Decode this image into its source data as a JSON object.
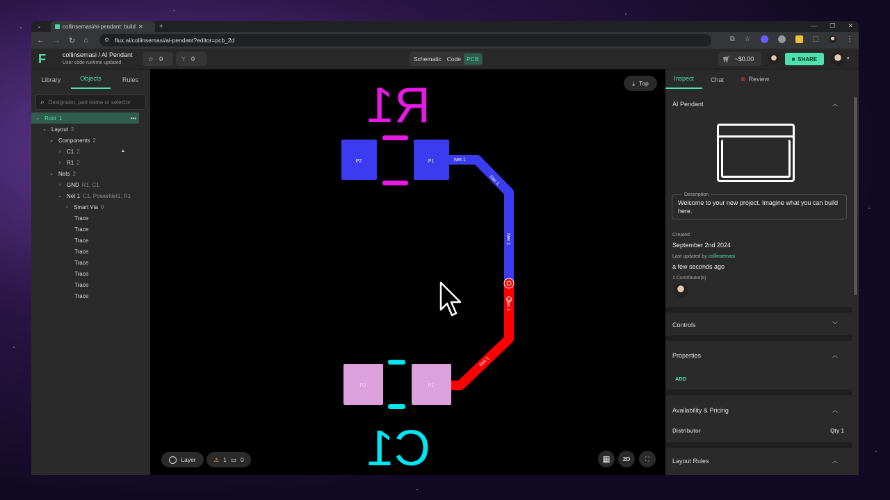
{
  "browser": {
    "tab_title": "collinsemasi/ai-pendant: build",
    "url": "flux.ai/collinsemasi/ai-pendant?editor=pcb_2d"
  },
  "header": {
    "project_path": "collinsemasi / AI Pendant",
    "status": "User code runtime updated",
    "stars": "0",
    "forks": "0",
    "modes": [
      "Schematic",
      "Code",
      "PCB"
    ],
    "active_mode": "PCB",
    "cart_price": "~$0.00",
    "share_label": "SHARE"
  },
  "left_panel": {
    "tabs": [
      "Library",
      "Objects",
      "Rules"
    ],
    "active_tab": "Objects",
    "search_placeholder": "Designator, part name or selector",
    "tree": {
      "root": {
        "label": "Root",
        "count": "1"
      },
      "layout": {
        "label": "Layout",
        "count": "2"
      },
      "components": {
        "label": "Components",
        "count": "2"
      },
      "c1": {
        "label": "C1",
        "count": "2"
      },
      "r1": {
        "label": "R1",
        "count": "2"
      },
      "nets": {
        "label": "Nets",
        "count": "2"
      },
      "gnd": {
        "label": "GND",
        "detail": "R1, C1"
      },
      "net1": {
        "label": "Net 1",
        "detail": "C1, PowerNet1, R1"
      },
      "smart_via": {
        "label": "Smart Via",
        "count": "9"
      },
      "traces": [
        "Trace",
        "Trace",
        "Trace",
        "Trace",
        "Trace",
        "Trace",
        "Trace",
        "Trace"
      ]
    }
  },
  "canvas": {
    "view_label": "Top",
    "layer_label": "Layer",
    "warnings": "1",
    "comments": "0",
    "mode_2d": "2D",
    "r1_designator": "R1",
    "c1_designator": "C1",
    "pad_p1": "P1",
    "pad_p2": "P2",
    "net_label": "Net 1",
    "colors": {
      "top_copper": "#3b3bf0",
      "bottom_copper": "#ff0000",
      "r1_silk": "#e619e6",
      "c1_silk": "#00e5f0",
      "c1_pads": "#dca0dc"
    }
  },
  "right_panel": {
    "tabs": [
      "Inspect",
      "Chat",
      "Review"
    ],
    "active_tab": "Inspect",
    "project_title": "AI Pendant",
    "description_label": "Description",
    "description": "Welcome to your new project. Imagine what you can build here.",
    "created_label": "Created",
    "created": "September 2nd 2024",
    "updated_label_prefix": "Last updated by",
    "updated_by": "collinsemasi",
    "updated": "a few seconds ago",
    "contributors": "1 Contributor(s)",
    "sections": {
      "controls": "Controls",
      "properties": "Properties",
      "add": "ADD",
      "availability": "Availability & Pricing",
      "distributor": "Distributor",
      "qty": "Qty 1",
      "layout_rules": "Layout Rules"
    }
  }
}
